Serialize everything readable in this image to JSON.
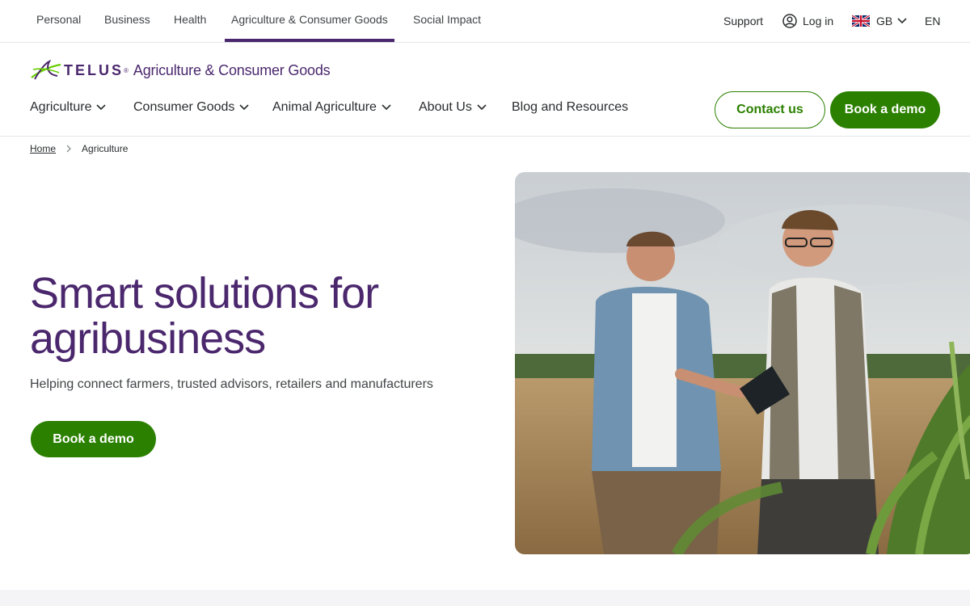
{
  "topbar": {
    "segments": [
      "Personal",
      "Business",
      "Health",
      "Agriculture & Consumer Goods",
      "Social Impact"
    ],
    "support": "Support",
    "login": "Log in",
    "region": "GB",
    "language": "EN"
  },
  "brand": {
    "name": "TELUS",
    "subtitle": "Agriculture & Consumer Goods"
  },
  "nav": {
    "items": [
      "Agriculture",
      "Consumer Goods",
      "Animal Agriculture",
      "About Us",
      "Blog and Resources"
    ],
    "contact_label": "Contact us",
    "demo_label": "Book a demo"
  },
  "breadcrumb": {
    "home": "Home",
    "current": "Agriculture"
  },
  "hero": {
    "title_line1": "Smart solutions for",
    "title_line2": "agribusiness",
    "subtitle": "Helping connect farmers, trusted advisors, retailers and manufacturers",
    "cta_label": "Book a demo"
  },
  "colors": {
    "brand_purple": "#4b286d",
    "brand_green": "#2b8000",
    "logo_green": "#66cc00"
  },
  "icons": [
    "user-circle-icon",
    "uk-flag-icon",
    "chevron-down-icon",
    "chevron-right-icon",
    "telus-logo-icon"
  ]
}
